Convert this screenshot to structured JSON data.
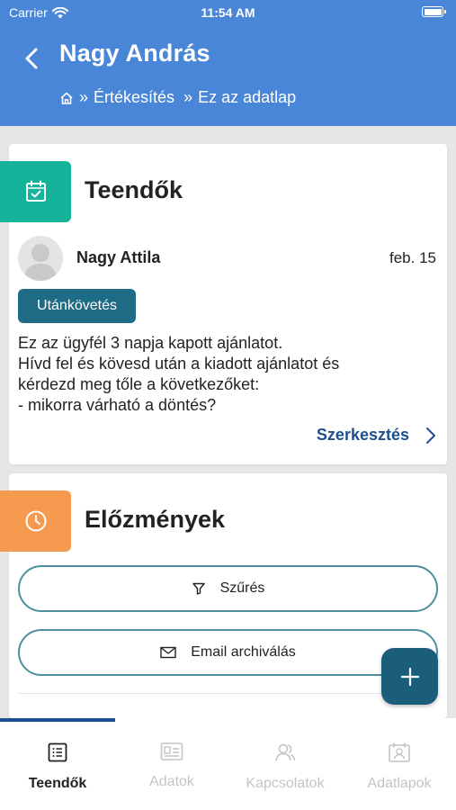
{
  "status_bar": {
    "carrier": "Carrier",
    "time": "11:54 AM"
  },
  "header": {
    "title": "Nagy András",
    "breadcrumb": [
      "»",
      "Értékesítés",
      "»",
      "Ez az adatlap"
    ]
  },
  "todo_card": {
    "title": "Teendők",
    "person": "Nagy Attila",
    "date": "feb. 15",
    "badge": "Utánkövetés",
    "note_lines": [
      "Ez az ügyfél 3 napja kapott ajánlatot.",
      "Hívd fel és kövesd után a kiadott ajánlatot és",
      "kérdezd meg tőle a következőket:",
      "- mikorra várható a döntés?"
    ],
    "edit_label": "Szerkesztés"
  },
  "history_card": {
    "title": "Előzmények",
    "filter_label": "Szűrés",
    "archive_label": "Email archiválás"
  },
  "tabs": [
    {
      "label": "Teendők",
      "icon": "list-icon",
      "active": true
    },
    {
      "label": "Adatok",
      "icon": "id-card-icon",
      "active": false
    },
    {
      "label": "Kapcsolatok",
      "icon": "contacts-icon",
      "active": false
    },
    {
      "label": "Adatlapok",
      "icon": "contact-sheet-icon",
      "active": false
    }
  ],
  "colors": {
    "header": "#4a86d8",
    "todo_accent": "#15b39a",
    "history_accent": "#f59a4f",
    "badge": "#1d6b85",
    "link": "#1e4f91",
    "fab": "#1b5e7c"
  }
}
